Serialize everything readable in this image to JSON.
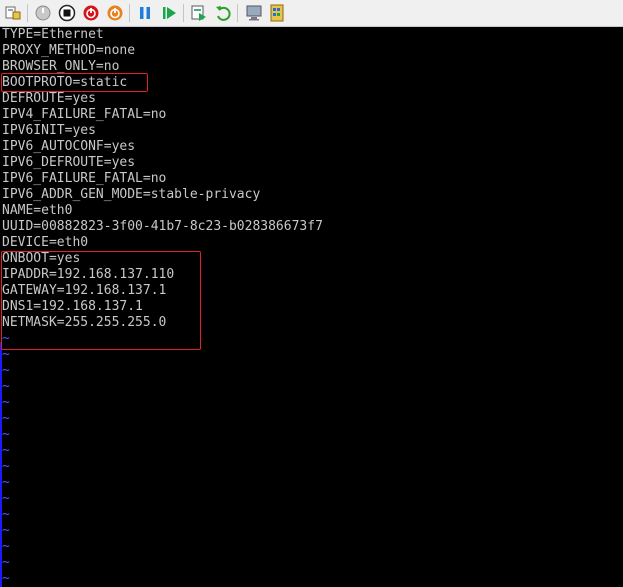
{
  "toolbar": {
    "buttons": [
      {
        "name": "toolbar-settings-icon",
        "glyph": "settings"
      },
      {
        "name": "toolbar-start-icon",
        "glyph": "start"
      },
      {
        "name": "toolbar-turnoff-icon",
        "glyph": "turnoff"
      },
      {
        "name": "toolbar-shutdown-icon",
        "glyph": "shutdown"
      },
      {
        "name": "toolbar-poweroff-icon",
        "glyph": "power"
      },
      {
        "name": "toolbar-pause-icon",
        "glyph": "pause"
      },
      {
        "name": "toolbar-resume-icon",
        "glyph": "play"
      },
      {
        "name": "toolbar-checkpoint-icon",
        "glyph": "checkpoint"
      },
      {
        "name": "toolbar-revert-icon",
        "glyph": "revert"
      },
      {
        "name": "toolbar-enhanced-session-icon",
        "glyph": "session"
      },
      {
        "name": "toolbar-share-icon",
        "glyph": "share"
      }
    ],
    "accent_colors": {
      "stop": "#d4141a",
      "power": "#e8821e",
      "pause": "#1f7fd8",
      "play": "#1aa64a",
      "revert": "#2aa02a"
    }
  },
  "terminal": {
    "text_color": "#c8c8c8",
    "tilde_color": "#4a5cff",
    "highlight_color": "#e0232a",
    "lines": [
      "TYPE=Ethernet",
      "PROXY_METHOD=none",
      "BROWSER_ONLY=no",
      "BOOTPROTO=static",
      "DEFROUTE=yes",
      "IPV4_FAILURE_FATAL=no",
      "IPV6INIT=yes",
      "IPV6_AUTOCONF=yes",
      "IPV6_DEFROUTE=yes",
      "IPV6_FAILURE_FATAL=no",
      "IPV6_ADDR_GEN_MODE=stable-privacy",
      "NAME=eth0",
      "UUID=00882823-3f00-41b7-8c23-b028386673f7",
      "DEVICE=eth0",
      "ONBOOT=yes",
      "IPADDR=192.168.137.110",
      "GATEWAY=192.168.137.1",
      "DNS1=192.168.137.1",
      "NETMASK=255.255.255.0",
      "~",
      "~",
      "~",
      "~",
      "~",
      "~",
      "~",
      "~",
      "~",
      "~",
      "~",
      "~",
      "~",
      "~",
      "~",
      "~"
    ]
  }
}
